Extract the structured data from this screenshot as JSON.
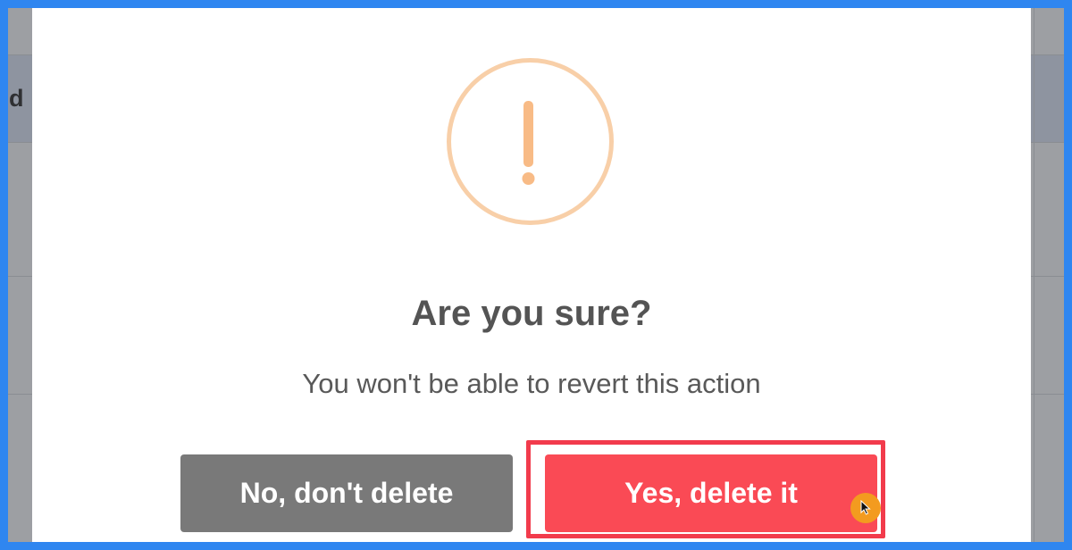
{
  "background": {
    "partial_heading": "d"
  },
  "dialog": {
    "icon": "exclamation-circle-icon",
    "icon_color": "#f8bb86",
    "title": "Are you sure?",
    "message": "You won't be able to revert this action",
    "cancel_label": "No, don't delete",
    "confirm_label": "Yes, delete it"
  },
  "colors": {
    "outer_border": "#2f86f0",
    "cancel_button": "#797979",
    "confirm_button": "#fa4a55",
    "highlight_box": "#f23b4c",
    "cursor_marker": "#f39b1f"
  },
  "cursor": {
    "icon": "mouse-pointer-icon"
  }
}
